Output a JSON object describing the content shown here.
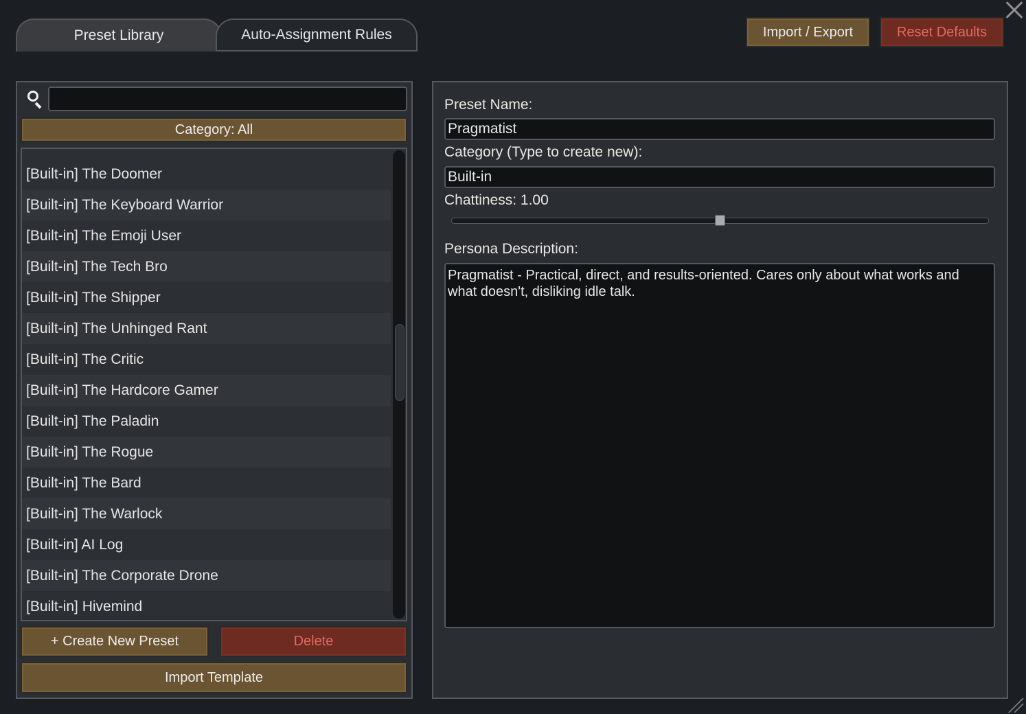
{
  "tabs": [
    {
      "label": "Preset Library",
      "active": true
    },
    {
      "label": "Auto-Assignment Rules",
      "active": false
    }
  ],
  "header": {
    "import_export_label": "Import / Export",
    "reset_defaults_label": "Reset Defaults",
    "close_icon": "close-icon"
  },
  "left": {
    "search_placeholder": "",
    "category_label": "Category: All",
    "items": [
      "[Built-in] The Doomer",
      "[Built-in] The Keyboard Warrior",
      "[Built-in] The Emoji User",
      "[Built-in] The Tech Bro",
      "[Built-in] The Shipper",
      "[Built-in] The Unhinged Rant",
      "[Built-in] The Critic",
      "[Built-in] The Hardcore Gamer",
      "[Built-in] The Paladin",
      "[Built-in] The Rogue",
      "[Built-in] The Bard",
      "[Built-in] The Warlock",
      "[Built-in] AI Log",
      "[Built-in] The Corporate Drone",
      "[Built-in] Hivemind"
    ],
    "create_label": "+ Create New Preset",
    "delete_label": "Delete",
    "import_template_label": "Import Template"
  },
  "right": {
    "preset_name_label": "Preset Name:",
    "preset_name_value": "Pragmatist",
    "category_label": "Category (Type to create new):",
    "category_value": "Built-in",
    "chattiness_label": "Chattiness: 1.00",
    "chattiness_value": 1.0,
    "chattiness_fraction": 0.5,
    "persona_label": "Persona Description:",
    "persona_value": "Pragmatist - Practical, direct, and results-oriented. Cares only about what works and what doesn't, disliking idle talk."
  },
  "colors": {
    "background": "#1b1e23",
    "panel": "#2a2d31",
    "gold_button": "#6b5431",
    "red_button": "#6d2b22",
    "red_text": "#e36a5c"
  }
}
